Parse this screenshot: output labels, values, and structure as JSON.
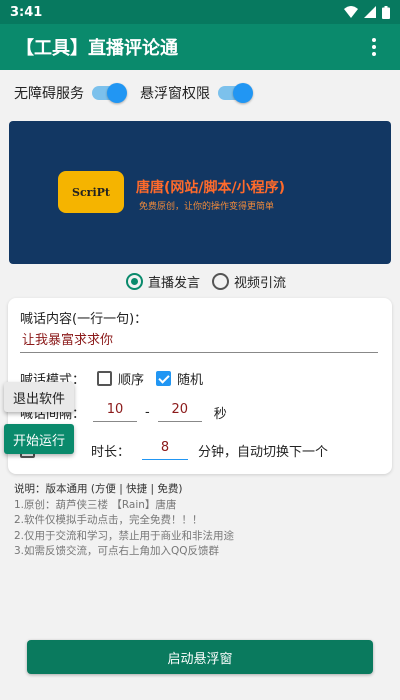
{
  "status_bar": {
    "time": "3:41"
  },
  "app_bar": {
    "title": "【工具】直播评论通"
  },
  "permissions": {
    "accessibility_label": "无障碍服务",
    "accessibility_on": true,
    "overlay_label": "悬浮窗权限",
    "overlay_on": true
  },
  "banner": {
    "logo_text": "ScriPt",
    "title": "唐唐(网站/脚本/小程序)",
    "subtitle": "免费原创，让你的操作变得更简单"
  },
  "mode": {
    "options": [
      "直播发言",
      "视频引流"
    ],
    "selected": "直播发言"
  },
  "settings": {
    "content_label": "喊话内容(一行一句)：",
    "content_value": "让我暴富求求你",
    "order_label": "喊话模式：",
    "order_options": [
      "顺序",
      "随机"
    ],
    "order_checked": [
      false,
      true
    ],
    "interval_label": "喊话间隔：",
    "interval_min": "10",
    "interval_max": "20",
    "interval_dash": "-",
    "interval_unit": "秒",
    "duration_label": "时长：",
    "duration_value": "8",
    "duration_suffix": "分钟，自动切换下一个"
  },
  "float_buttons": {
    "exit_label": "退出软件",
    "start_label": "开始运行"
  },
  "notes": {
    "title": "说明：版本通用 (方便 | 快捷 | 免费)",
    "lines": [
      "1.原创：葫芦侠三楼 【Rain】唐唐",
      "2.软件仅模拟手动点击，完全免费！！！",
      "2.仅用于交流和学习，禁止用于商业和非法用途",
      "3.如需反馈交流，可点右上角加入QQ反馈群"
    ]
  },
  "launch_button": {
    "label": "启动悬浮窗"
  },
  "colors": {
    "primary": "#0a8a6c",
    "switch_blue": "#2196f3",
    "banner_bg": "#123763"
  }
}
